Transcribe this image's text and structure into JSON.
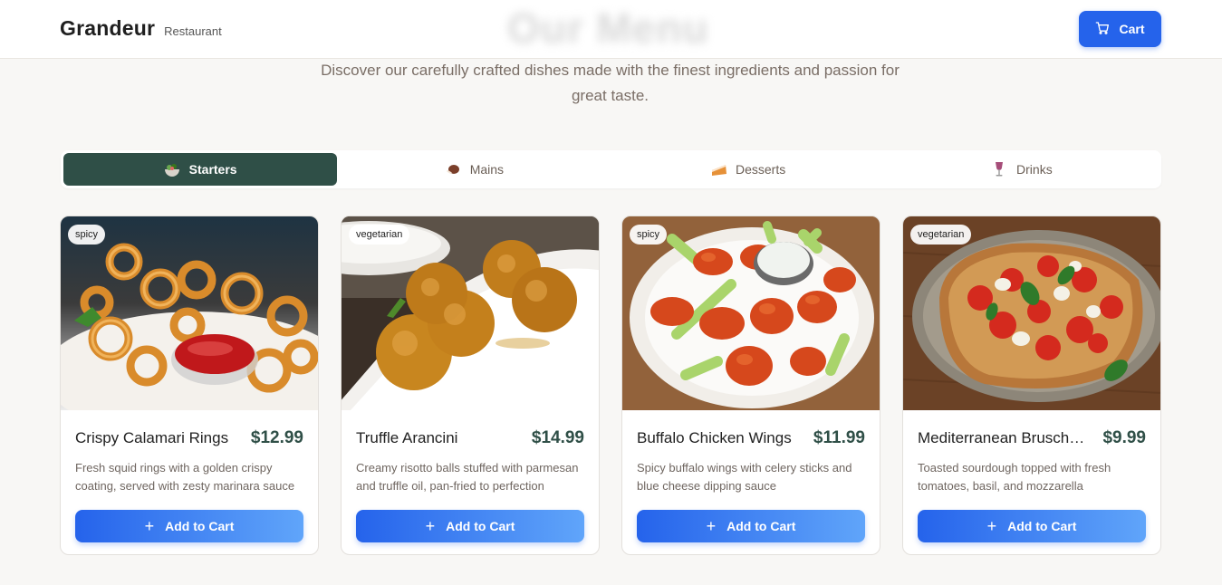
{
  "header": {
    "brand": "Grandeur",
    "brand_sub": "Restaurant",
    "cart_label": "Cart"
  },
  "hero": {
    "subtitle": "Discover our carefully crafted dishes made with the finest ingredients and passion for great taste."
  },
  "tabs": [
    {
      "label": "Starters",
      "icon": "salad-icon",
      "active": true
    },
    {
      "label": "Mains",
      "icon": "meat-icon",
      "active": false
    },
    {
      "label": "Desserts",
      "icon": "cake-icon",
      "active": false
    },
    {
      "label": "Drinks",
      "icon": "wine-glass-icon",
      "active": false
    }
  ],
  "menu": {
    "items": [
      {
        "badge": "spicy",
        "name": "Crispy Calamari Rings",
        "price": "$12.99",
        "description": "Fresh squid rings with a golden crispy coating, served with zesty marinara sauce",
        "button": "Add to Cart"
      },
      {
        "badge": "vegetarian",
        "name": "Truffle Arancini",
        "price": "$14.99",
        "description": "Creamy risotto balls stuffed with parmesan and truffle oil, pan-fried to perfection",
        "button": "Add to Cart"
      },
      {
        "badge": "spicy",
        "name": "Buffalo Chicken Wings",
        "price": "$11.99",
        "description": "Spicy buffalo wings with celery sticks and blue cheese dipping sauce",
        "button": "Add to Cart"
      },
      {
        "badge": "vegetarian",
        "name": "Mediterranean Bruschetta",
        "price": "$9.99",
        "description": "Toasted sourdough topped with fresh tomatoes, basil, and mozzarella",
        "button": "Add to Cart"
      }
    ]
  },
  "colors": {
    "accent_blue": "#2563eb",
    "tab_active": "#2f4f47",
    "background": "#f8f7f5"
  }
}
